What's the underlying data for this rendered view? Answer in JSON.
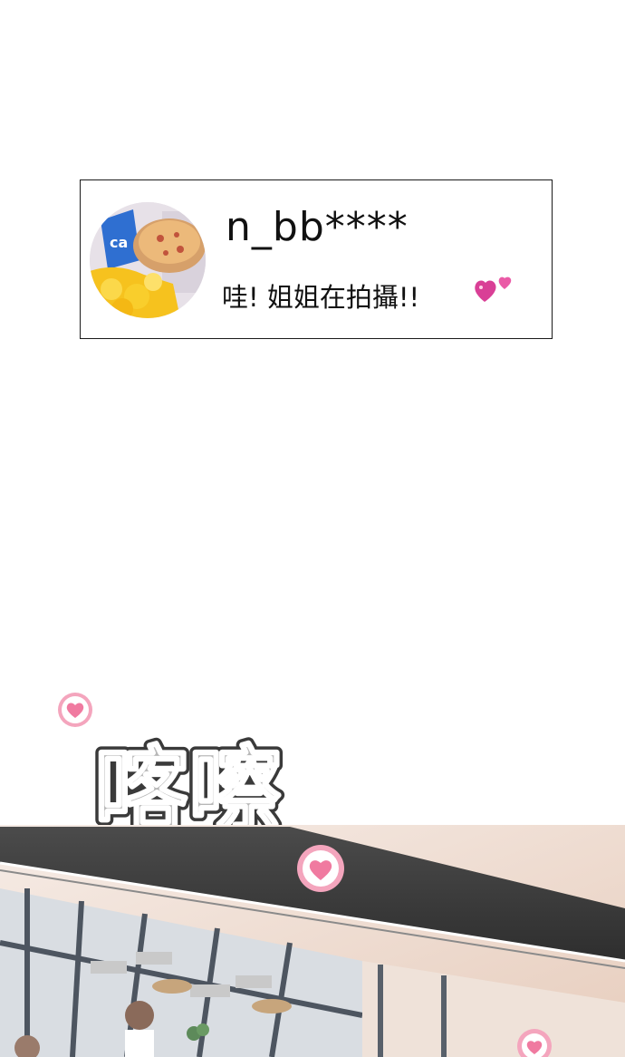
{
  "comment": {
    "username": "n_bb****",
    "text": "哇! 姐姐在拍攝!!",
    "avatar_icon": "avatar-food-photo-icon",
    "emoji_icon": "two-hearts-icon"
  },
  "sound_effect": {
    "text": "喀嚓"
  },
  "colors": {
    "border": "#1a1a1a",
    "heart_pink": "#f07aa0",
    "heart_emoji": "#e0449a",
    "sfx_gray": "#9a9a9a",
    "roof_dark": "#3a3a3a",
    "wall_warm": "#f3e5dc"
  }
}
